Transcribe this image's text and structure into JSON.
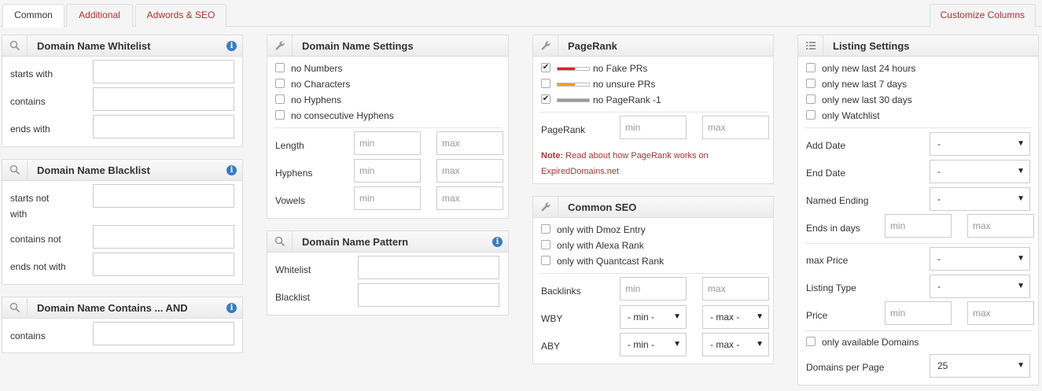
{
  "tabs": [
    "Common",
    "Additional",
    "Adwords & SEO"
  ],
  "customize_label": "Customize Columns",
  "whitelist": {
    "title": "Domain Name Whitelist",
    "info": "i",
    "starts_with": "starts with",
    "contains": "contains",
    "ends_with": "ends with"
  },
  "blacklist": {
    "title": "Domain Name Blacklist",
    "info": "i",
    "starts_not_with_1": "starts not",
    "starts_not_with_2": "with",
    "contains_not": "contains not",
    "ends_not_with": "ends not with"
  },
  "contains_and": {
    "title": "Domain Name Contains ... AND",
    "info": "i",
    "contains": "contains"
  },
  "settings": {
    "title": "Domain Name Settings",
    "checks": [
      "no Numbers",
      "no Characters",
      "no Hyphens",
      "no consecutive Hyphens"
    ],
    "length": "Length",
    "hyphens": "Hyphens",
    "vowels": "Vowels",
    "min": "min",
    "max": "max"
  },
  "pattern": {
    "title": "Domain Name Pattern",
    "info": "i",
    "whitelist": "Whitelist",
    "blacklist": "Blacklist"
  },
  "pagerank": {
    "title": "PageRank",
    "checks": [
      {
        "label": "no Fake PRs",
        "checked": true,
        "color": "#e02020",
        "fill": 0.55
      },
      {
        "label": "no unsure PRs",
        "checked": false,
        "color": "#e8a317",
        "fill": 0.55
      },
      {
        "label": "no PageRank -1",
        "checked": true,
        "color": "#999999",
        "fill": 1.0
      }
    ],
    "pagerank_label": "PageRank",
    "min": "min",
    "max": "max",
    "note_strong": "Note:",
    "note_text": " Read about how PageRank works on",
    "note_text2": "ExpiredDomains.net"
  },
  "seo": {
    "title": "Common SEO",
    "checks": [
      "only with Dmoz Entry",
      "only with Alexa Rank",
      "only with Quantcast Rank"
    ],
    "backlinks": "Backlinks",
    "wby": "WBY",
    "aby": "ABY",
    "min": "min",
    "max": "max",
    "min_sel": "- min -",
    "max_sel": "- max -"
  },
  "listing": {
    "title": "Listing Settings",
    "checks": [
      "only new last 24 hours",
      "only new last 7 days",
      "only new last 30 days",
      "only Watchlist"
    ],
    "add_date": "Add Date",
    "end_date": "End Date",
    "named_ending": "Named Ending",
    "ends_in_days": "Ends in days",
    "max_price": "max Price",
    "listing_type": "Listing Type",
    "price": "Price",
    "only_available": "only available Domains",
    "domains_per_page": "Domains per Page",
    "dash": "-",
    "per_page_value": "25",
    "min": "min",
    "max": "max"
  }
}
